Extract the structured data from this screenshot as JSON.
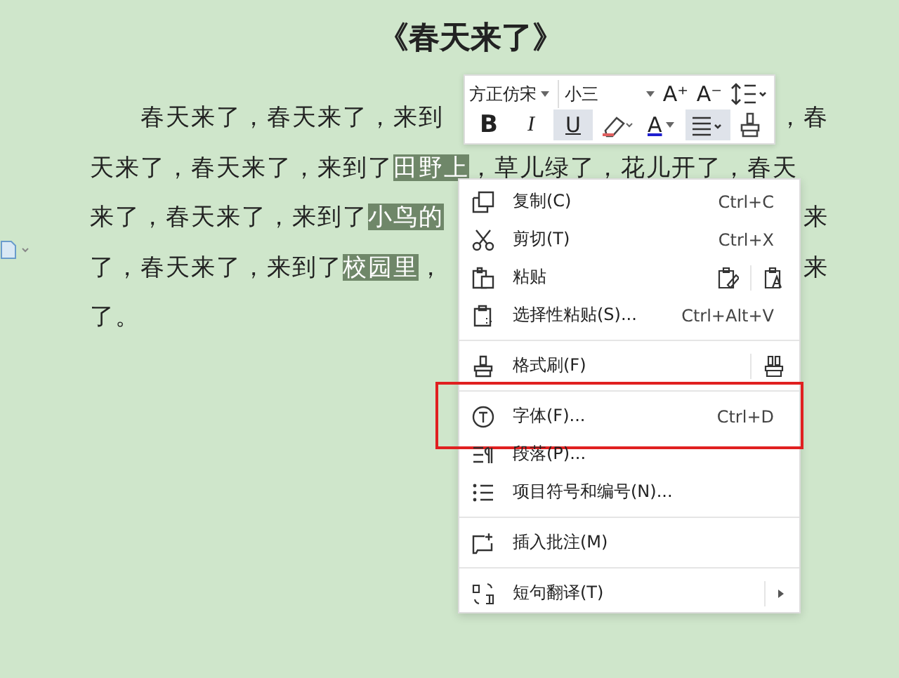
{
  "document": {
    "title": "《春天来了》",
    "lines": [
      {
        "left": [
          {
            "text": "春天来了，春天来了，来到",
            "selected": false
          }
        ],
        "right": [
          {
            "text": "，春",
            "selected": false
          }
        ]
      },
      {
        "left": [
          {
            "text": "天来了，春天来了，来到了",
            "selected": false
          },
          {
            "text": "田野上",
            "selected": true
          },
          {
            "text": "，草儿绿了，花儿开了，春天",
            "selected": false
          }
        ]
      },
      {
        "left": [
          {
            "text": "来了，春天来了，来到了",
            "selected": false
          },
          {
            "text": "小鸟的",
            "selected": true
          }
        ],
        "right": [
          {
            "text": "来",
            "selected": false
          }
        ]
      },
      {
        "left": [
          {
            "text": "了，春天来了，来到了",
            "selected": false
          },
          {
            "text": "校园里",
            "selected": true
          },
          {
            "text": "，",
            "selected": false
          }
        ],
        "right": [
          {
            "text": "来",
            "selected": false
          }
        ]
      },
      {
        "left": [
          {
            "text": "了。",
            "selected": false
          }
        ]
      }
    ]
  },
  "toolbar": {
    "font": "方正仿宋",
    "size": "小三",
    "row1": [
      {
        "kind": "grow",
        "label": "A⁺"
      },
      {
        "kind": "shrink",
        "label": "A⁻"
      },
      {
        "kind": "spacing"
      }
    ],
    "row2": [
      {
        "kind": "bold",
        "label": "B",
        "selected": false
      },
      {
        "kind": "italic",
        "label": "I",
        "selected": false
      },
      {
        "kind": "underline",
        "label": "U",
        "selected": true
      },
      {
        "kind": "highlight",
        "selected": false
      },
      {
        "kind": "color",
        "label": "A",
        "selected": false
      },
      {
        "kind": "align",
        "selected": true
      },
      {
        "kind": "painter",
        "selected": false
      }
    ]
  },
  "menu": {
    "groups": [
      [
        {
          "kind": "shortcut",
          "label": "复制(C)",
          "shortcut": "Ctrl+C",
          "highlighted": false
        },
        {
          "kind": "shortcut",
          "label": "剪切(T)",
          "shortcut": "Ctrl+X",
          "highlighted": false
        },
        {
          "kind": "paste-options",
          "label": "粘贴",
          "highlighted": false
        },
        {
          "kind": "shortcut",
          "label": "选择性粘贴(S)...",
          "shortcut": "Ctrl+Alt+V",
          "highlighted": false
        }
      ],
      [
        {
          "kind": "painter",
          "label": "格式刷(F)",
          "highlighted": false
        }
      ],
      [
        {
          "kind": "shortcut",
          "label": "字体(F)...",
          "shortcut": "Ctrl+D",
          "highlighted": true
        },
        {
          "kind": "shortcut",
          "label": "段落(P)...",
          "highlighted": false
        },
        {
          "kind": "shortcut",
          "label": "项目符号和编号(N)...",
          "highlighted": false
        }
      ],
      [
        {
          "kind": "shortcut",
          "label": "插入批注(M)",
          "highlighted": false
        }
      ],
      [
        {
          "kind": "submenu",
          "label": "短句翻译(T)",
          "highlighted": false
        }
      ]
    ]
  }
}
